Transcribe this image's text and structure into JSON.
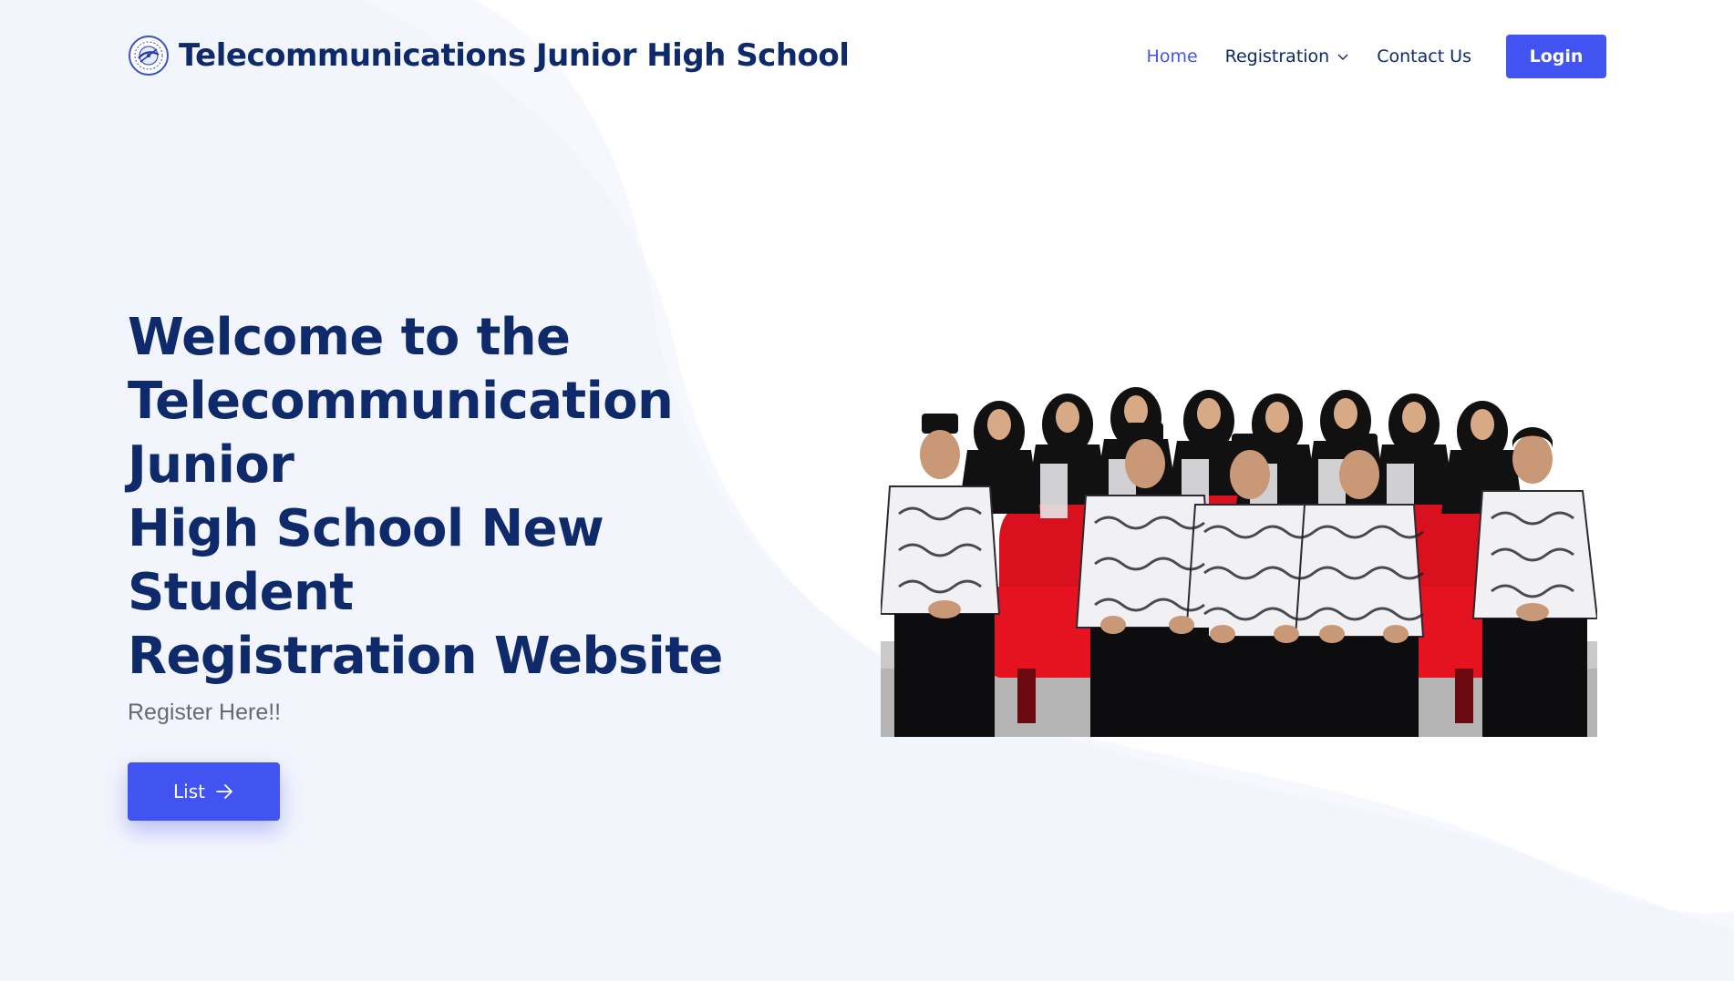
{
  "brand": {
    "name": "Telecommunications Junior High School",
    "logo_icon": "school-logo-icon"
  },
  "nav": {
    "home": "Home",
    "registration": "Registration",
    "contact": "Contact Us",
    "login": "Login",
    "registration_icon": "chevron-down-icon"
  },
  "hero": {
    "title_line1": "Welcome to the",
    "title_line2": "Telecommunication Junior",
    "title_line3": "High School New Student",
    "title_line4": "Registration Website",
    "subtitle": "Register Here!!",
    "button_label": "List",
    "button_icon": "arrow-right-icon"
  },
  "colors": {
    "primary": "#4154f1",
    "heading": "#0e2a6b",
    "muted": "#666a75",
    "wave": "#f3f5fc"
  }
}
